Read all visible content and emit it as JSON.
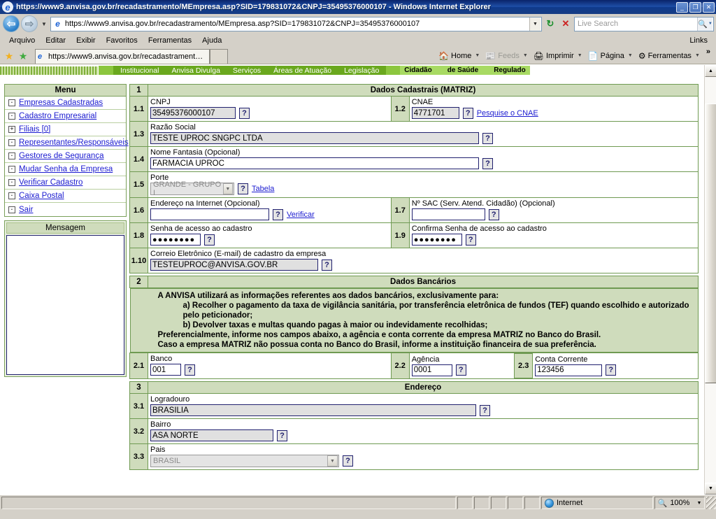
{
  "window": {
    "title": "https://www9.anvisa.gov.br/recadastramento/MEmpresa.asp?SID=179831072&CNPJ=35495376000107 - Windows Internet Explorer",
    "minimize": "_",
    "restore": "❐",
    "close": "✕"
  },
  "address_bar": {
    "url": "https://www9.anvisa.gov.br/recadastramento/MEmpresa.asp?SID=179831072&CNPJ=35495376000107",
    "back_icon": "back-arrow-icon",
    "forward_icon": "forward-arrow-icon",
    "refresh_icon": "↻",
    "stop_icon": "✕",
    "search_placeholder": "Live Search",
    "search_icon": "🔍"
  },
  "menu_bar": {
    "items": [
      "Arquivo",
      "Editar",
      "Exibir",
      "Favoritos",
      "Ferramentas",
      "Ajuda"
    ],
    "links_label": "Links"
  },
  "command_bar": {
    "favorites_star": "favorites-star-icon",
    "add_favorite": "add-to-favorites-icon",
    "tab_label": "https://www9.anvisa.gov.br/recadastramento/MEmp...",
    "buttons": [
      {
        "label": "Home",
        "icon": "home-icon",
        "disabled": false
      },
      {
        "label": "Feeds",
        "icon": "feeds-icon",
        "disabled": true
      },
      {
        "label": "Imprimir",
        "icon": "printer-icon",
        "disabled": false
      },
      {
        "label": "Página",
        "icon": "page-icon",
        "disabled": false
      },
      {
        "label": "Ferramentas",
        "icon": "gear-icon",
        "disabled": false
      }
    ],
    "overflow": "»"
  },
  "site_nav": {
    "primary": [
      "Institucional",
      "Anvisa Divulga",
      "Serviços",
      "Áreas de Atuação",
      "Legislação"
    ],
    "secondary": [
      "Cidadão",
      "de Saúde",
      "Regulado"
    ]
  },
  "sidebar": {
    "menu_title": "Menu",
    "items": [
      {
        "icon": "·",
        "label": "Empresas Cadastradas"
      },
      {
        "icon": "·",
        "label": "Cadastro Empresarial"
      },
      {
        "icon": "+",
        "label": "Filiais [0]"
      },
      {
        "icon": "·",
        "label": "Representantes/Responsáveis"
      },
      {
        "icon": "·",
        "label": "Gestores de Segurança"
      },
      {
        "icon": "·",
        "label": "Mudar Senha da Empresa"
      },
      {
        "icon": "·",
        "label": "Verificar Cadastro"
      },
      {
        "icon": "·",
        "label": "Caixa Postal"
      },
      {
        "icon": "·",
        "label": "Sair"
      }
    ],
    "message_title": "Mensagem",
    "message_body": ""
  },
  "form": {
    "help_glyph": "?",
    "section1": {
      "number": "1",
      "title": "Dados Cadastrais (MATRIZ)",
      "f1_1": {
        "num": "1.1",
        "label": "CNPJ",
        "value": "35495376000107",
        "readonly": true
      },
      "f1_2": {
        "num": "1.2",
        "label": "CNAE",
        "value": "4771701",
        "readonly": true,
        "link": "Pesquise o CNAE"
      },
      "f1_3": {
        "num": "1.3",
        "label": "Razão Social",
        "value": "TESTE UPROC SNGPC LTDA",
        "readonly": true
      },
      "f1_4": {
        "num": "1.4",
        "label": "Nome Fantasia (Opcional)",
        "value": "FARMACIA UPROC",
        "readonly": false
      },
      "f1_5": {
        "num": "1.5",
        "label": "Porte",
        "value": "GRANDE - GRUPO I",
        "link": "Tabela"
      },
      "f1_6": {
        "num": "1.6",
        "label": "Endereço na Internet (Opcional)",
        "value": "",
        "link": "Verificar"
      },
      "f1_7": {
        "num": "1.7",
        "label": "Nº SAC (Serv. Atend. Cidadão) (Opcional)",
        "value": ""
      },
      "f1_8": {
        "num": "1.8",
        "label": "Senha de acesso ao cadastro",
        "value": "●●●●●●●●"
      },
      "f1_9": {
        "num": "1.9",
        "label": "Confirma Senha de acesso ao cadastro",
        "value": "●●●●●●●●"
      },
      "f1_10": {
        "num": "1.10",
        "label": "Correio Eletrônico (E-mail) de cadastro da empresa",
        "value": "TESTEUPROC@ANVISA.GOV.BR",
        "readonly": true
      }
    },
    "section2": {
      "number": "2",
      "title": "Dados Bancários",
      "notice": [
        "A ANVISA utilizará as informações referentes aos dados bancários, exclusivamente para:",
        "a) Recolher o pagamento da taxa de vigilância sanitária, por transferência eletrônica de fundos (TEF) quando escolhido e autorizado pelo peticionador;",
        "b) Devolver taxas e multas quando pagas à maior ou indevidamente recolhidas;",
        "Preferencialmente, informe nos campos abaixo, a agência e conta corrente da empresa MATRIZ no Banco do Brasil.",
        "Caso a empresa MATRIZ não possua conta no Banco do Brasil, informe a instituição financeira de sua preferência."
      ],
      "f2_1": {
        "num": "2.1",
        "label": "Banco",
        "value": "001"
      },
      "f2_2": {
        "num": "2.2",
        "label": "Agência",
        "value": "0001"
      },
      "f2_3": {
        "num": "2.3",
        "label": "Conta Corrente",
        "value": "123456"
      }
    },
    "section3": {
      "number": "3",
      "title": "Endereço",
      "f3_1": {
        "num": "3.1",
        "label": "Logradouro",
        "value": "BRASILIA",
        "readonly": true
      },
      "f3_2": {
        "num": "3.2",
        "label": "Bairro",
        "value": "ASA NORTE",
        "readonly": true
      },
      "f3_3": {
        "num": "3.3",
        "label": "Pais",
        "value": "BRASIL"
      }
    }
  },
  "status_bar": {
    "message": "",
    "zone": "Internet",
    "zone_icon": "globe-icon",
    "zoom": "100%",
    "zoom_icon": "magnifier-icon"
  }
}
